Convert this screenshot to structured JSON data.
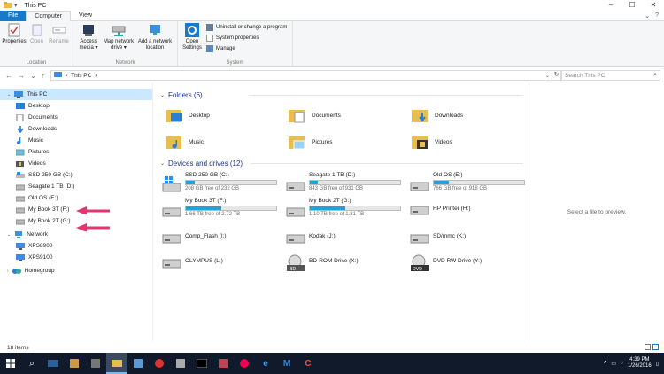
{
  "window": {
    "title": "This PC",
    "qat": "▾"
  },
  "tabs": [
    {
      "label": "File"
    },
    {
      "label": "Computer"
    },
    {
      "label": "View"
    }
  ],
  "ribbon": {
    "location": {
      "group_name": "Location",
      "buttons": [
        {
          "label": "Properties"
        },
        {
          "label": "Open"
        },
        {
          "label": "Rename"
        }
      ]
    },
    "network": {
      "group_name": "Network",
      "buttons": [
        {
          "label": "Access media ▾"
        },
        {
          "label": "Map network drive ▾"
        },
        {
          "label": "Add a network location"
        }
      ]
    },
    "system": {
      "group_name": "System",
      "open_settings": "Open Settings",
      "items": [
        {
          "label": "Uninstall or change a program"
        },
        {
          "label": "System properties"
        },
        {
          "label": "Manage"
        }
      ]
    }
  },
  "address": {
    "path": "This PC",
    "sep": "›",
    "search_placeholder": "Search This PC"
  },
  "sidebar": {
    "items": [
      {
        "label": "This PC",
        "icon": "monitor-icon"
      },
      {
        "label": "Desktop",
        "icon": "desktop-folder-icon"
      },
      {
        "label": "Documents",
        "icon": "documents-icon"
      },
      {
        "label": "Downloads",
        "icon": "downloads-icon"
      },
      {
        "label": "Music",
        "icon": "music-icon"
      },
      {
        "label": "Pictures",
        "icon": "pictures-icon"
      },
      {
        "label": "Videos",
        "icon": "videos-icon"
      },
      {
        "label": "SSD 250 GB (C:)",
        "icon": "windows-drive-icon"
      },
      {
        "label": "Seagate 1 TB (D:)",
        "icon": "drive-icon"
      },
      {
        "label": "Old OS (E:)",
        "icon": "drive-icon"
      },
      {
        "label": "My Book 3T (F:)",
        "icon": "drive-icon"
      },
      {
        "label": "My Book 2T (G:)",
        "icon": "drive-icon"
      },
      {
        "label": "Network",
        "icon": "network-icon"
      },
      {
        "label": "XPS8900",
        "icon": "computer-icon"
      },
      {
        "label": "XPS9100",
        "icon": "computer-icon"
      },
      {
        "label": "Homegroup",
        "icon": "homegroup-icon"
      }
    ]
  },
  "folders": {
    "header": "Folders (6)",
    "items": [
      {
        "label": "Desktop"
      },
      {
        "label": "Documents"
      },
      {
        "label": "Downloads"
      },
      {
        "label": "Music"
      },
      {
        "label": "Pictures"
      },
      {
        "label": "Videos"
      }
    ]
  },
  "drives": {
    "header": "Devices and drives (12)",
    "items": [
      {
        "label": "SSD 250 GB (C:)",
        "free": "208 GB free of 232 GB",
        "used_fraction": 0.1
      },
      {
        "label": "Seagate 1 TB (D:)",
        "free": "843 GB free of 931 GB",
        "used_fraction": 0.09
      },
      {
        "label": "Old OS (E:)",
        "free": "766 GB free of 918 GB",
        "used_fraction": 0.17
      },
      {
        "label": "My Book 3T (F:)",
        "free": "1.66 TB free of 2.72 TB",
        "used_fraction": 0.39
      },
      {
        "label": "My Book 2T (G:)",
        "free": "1.10 TB free of 1.81 TB",
        "used_fraction": 0.39
      },
      {
        "label": "HP Printer (H:)"
      },
      {
        "label": "Comp_Flash (I:)"
      },
      {
        "label": "Kodak (J:)"
      },
      {
        "label": "SD/mmc (K:)"
      },
      {
        "label": "OLYMPUS (L:)"
      },
      {
        "label": "BD-ROM Drive (X:)"
      },
      {
        "label": "DVD RW Drive (Y:)"
      }
    ]
  },
  "preview": {
    "text": "Select a file to preview."
  },
  "status": {
    "count": "18 items"
  },
  "clock": {
    "time": "4:39 PM",
    "date": "1/26/2016"
  },
  "colors": {
    "accent": "#1979ca",
    "bar": "#26a0da",
    "arrow": "#e8336e"
  }
}
